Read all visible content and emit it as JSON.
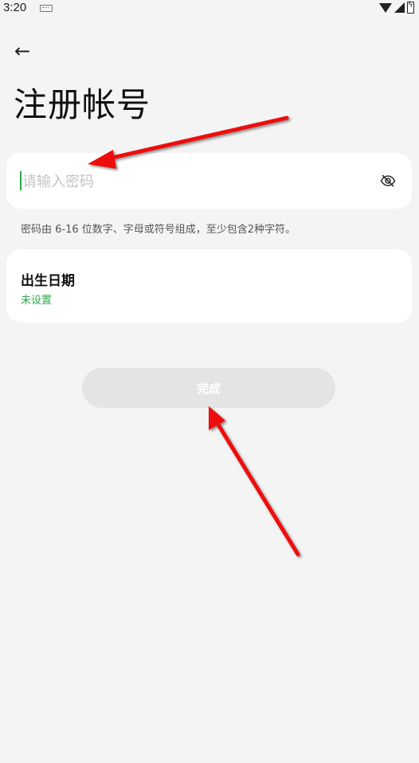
{
  "status_bar": {
    "time": "3:20",
    "icons": [
      "keyboard-icon",
      "wifi-icon",
      "signal-icon",
      "battery-icon"
    ]
  },
  "header": {
    "back_icon": "←",
    "title": "注册帐号"
  },
  "password": {
    "placeholder": "请输入密码",
    "value": "",
    "toggle_icon": "eye-off-icon"
  },
  "hint": "密码由 6-16 位数字、字母或符号组成，至少包含2种字符。",
  "birth_date": {
    "label": "出生日期",
    "value": "未设置"
  },
  "done_button": {
    "label": "完成"
  },
  "colors": {
    "background": "#f4f4f4",
    "accent_green": "#2aa84a",
    "annotation_red": "#ee1111",
    "button_disabled": "#e4e4e4"
  }
}
